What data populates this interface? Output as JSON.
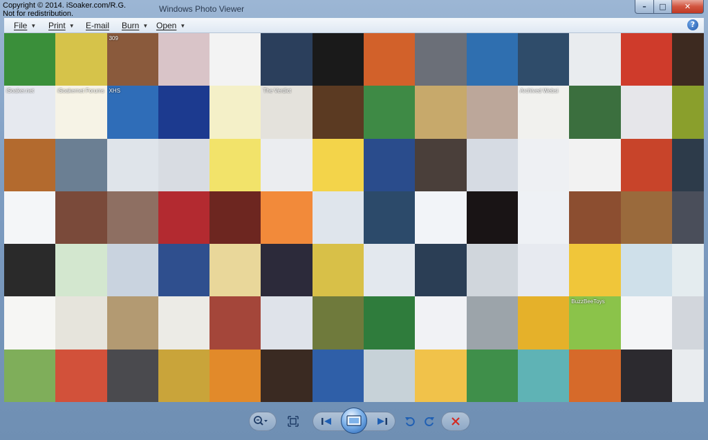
{
  "window": {
    "title": "Windows Photo Viewer",
    "copyright_line1": "Copyright © 2014. iSoaker.com/R.G.",
    "copyright_line2": "Not for redistribution.",
    "caption_buttons": {
      "minimize": "–",
      "maximize": "□",
      "close": "✕"
    }
  },
  "menu": {
    "items": [
      {
        "label": "File",
        "has_dropdown": true
      },
      {
        "label": "Print",
        "has_dropdown": true
      },
      {
        "label": "E-mail",
        "has_dropdown": false
      },
      {
        "label": "Burn",
        "has_dropdown": true
      },
      {
        "label": "Open",
        "has_dropdown": true
      }
    ],
    "help_label": "?"
  },
  "mosaic": {
    "tiles": [
      {
        "c": "#3a8f3a",
        "t": ""
      },
      {
        "c": "#d6c34a",
        "t": ""
      },
      {
        "c": "#8a5a3c",
        "t": "309"
      },
      {
        "c": "#d9c4c8",
        "t": ""
      },
      {
        "c": "#f3f3f3",
        "t": ""
      },
      {
        "c": "#2b3f5c",
        "t": ""
      },
      {
        "c": "#1a1a1a",
        "t": ""
      },
      {
        "c": "#d2612a",
        "t": ""
      },
      {
        "c": "#6b6f78",
        "t": ""
      },
      {
        "c": "#2f6fb0",
        "t": ""
      },
      {
        "c": "#2f4c6a",
        "t": ""
      },
      {
        "c": "#e9ecef",
        "t": ""
      },
      {
        "c": "#cf3b2b",
        "t": ""
      },
      {
        "c": "#3d2a20",
        "t": ""
      },
      {
        "c": "#e6e9ef",
        "t": "iSoaker.net"
      },
      {
        "c": "#f6f3e6",
        "t": "iSoakernet Forums"
      },
      {
        "c": "#2f6db8",
        "t": "XHS"
      },
      {
        "c": "#1c3a8f",
        "t": ""
      },
      {
        "c": "#f4f0c8",
        "t": ""
      },
      {
        "c": "#e4e2dc",
        "t": "The Verdict"
      },
      {
        "c": "#5b3a22",
        "t": ""
      },
      {
        "c": "#3e8a45",
        "t": ""
      },
      {
        "c": "#c7a96b",
        "t": ""
      },
      {
        "c": "#bca79a",
        "t": ""
      },
      {
        "c": "#f1f1ee",
        "t": "Archived Websi"
      },
      {
        "c": "#3b6f3e",
        "t": ""
      },
      {
        "c": "#e6e6ea",
        "t": ""
      },
      {
        "c": "#8a9f2c",
        "t": ""
      },
      {
        "c": "#b36a2e",
        "t": ""
      },
      {
        "c": "#6b7f93",
        "t": ""
      },
      {
        "c": "#dfe4ea",
        "t": ""
      },
      {
        "c": "#d8dce2",
        "t": ""
      },
      {
        "c": "#f2e36a",
        "t": ""
      },
      {
        "c": "#ebedf0",
        "t": ""
      },
      {
        "c": "#f3d44a",
        "t": ""
      },
      {
        "c": "#2a4c8c",
        "t": ""
      },
      {
        "c": "#4a3f3a",
        "t": ""
      },
      {
        "c": "#d6dbe3",
        "t": ""
      },
      {
        "c": "#eef0f3",
        "t": ""
      },
      {
        "c": "#f2f2f2",
        "t": ""
      },
      {
        "c": "#c8442a",
        "t": ""
      },
      {
        "c": "#2d3b4a",
        "t": ""
      },
      {
        "c": "#f4f6f8",
        "t": ""
      },
      {
        "c": "#7a4a3a",
        "t": ""
      },
      {
        "c": "#8e6f62",
        "t": ""
      },
      {
        "c": "#b32a30",
        "t": ""
      },
      {
        "c": "#6d2620",
        "t": ""
      },
      {
        "c": "#f28a3a",
        "t": ""
      },
      {
        "c": "#dfe5ec",
        "t": ""
      },
      {
        "c": "#2c4a6a",
        "t": ""
      },
      {
        "c": "#f2f4f8",
        "t": ""
      },
      {
        "c": "#191415",
        "t": ""
      },
      {
        "c": "#eef1f5",
        "t": ""
      },
      {
        "c": "#8c4e30",
        "t": ""
      },
      {
        "c": "#9a6a3c",
        "t": ""
      },
      {
        "c": "#4a4e5a",
        "t": ""
      },
      {
        "c": "#2a2a2a",
        "t": ""
      },
      {
        "c": "#d3e7cf",
        "t": ""
      },
      {
        "c": "#c9d3df",
        "t": ""
      },
      {
        "c": "#2f4f8e",
        "t": ""
      },
      {
        "c": "#e9d79a",
        "t": ""
      },
      {
        "c": "#2c2a3a",
        "t": ""
      },
      {
        "c": "#d8c048",
        "t": ""
      },
      {
        "c": "#e3e8ee",
        "t": ""
      },
      {
        "c": "#2b3e55",
        "t": ""
      },
      {
        "c": "#d0d6dc",
        "t": ""
      },
      {
        "c": "#e7eaf0",
        "t": ""
      },
      {
        "c": "#f0c63a",
        "t": ""
      },
      {
        "c": "#cfe0ea",
        "t": ""
      },
      {
        "c": "#e4ecef",
        "t": ""
      },
      {
        "c": "#f6f6f4",
        "t": ""
      },
      {
        "c": "#e6e4dc",
        "t": ""
      },
      {
        "c": "#b39a72",
        "t": ""
      },
      {
        "c": "#ecebe6",
        "t": ""
      },
      {
        "c": "#a4463a",
        "t": ""
      },
      {
        "c": "#dfe3ea",
        "t": ""
      },
      {
        "c": "#6f7a3c",
        "t": ""
      },
      {
        "c": "#2f7c3c",
        "t": ""
      },
      {
        "c": "#f1f2f5",
        "t": ""
      },
      {
        "c": "#9ca4aa",
        "t": ""
      },
      {
        "c": "#e5b12a",
        "t": ""
      },
      {
        "c": "#8bc34a",
        "t": "BuzzBeeToys"
      },
      {
        "c": "#f4f5f7",
        "t": ""
      },
      {
        "c": "#d2d6dc",
        "t": ""
      },
      {
        "c": "#7fae5a",
        "t": ""
      },
      {
        "c": "#d2513a",
        "t": ""
      },
      {
        "c": "#4a4a4e",
        "t": ""
      },
      {
        "c": "#c9a43a",
        "t": ""
      },
      {
        "c": "#e28a2a",
        "t": ""
      },
      {
        "c": "#3a2a22",
        "t": ""
      },
      {
        "c": "#2f5fa8",
        "t": ""
      },
      {
        "c": "#c7d2d8",
        "t": ""
      },
      {
        "c": "#f1c24a",
        "t": ""
      },
      {
        "c": "#3f8f4a",
        "t": ""
      },
      {
        "c": "#5fb3b5",
        "t": ""
      },
      {
        "c": "#d66a2a",
        "t": ""
      },
      {
        "c": "#2c2a2f",
        "t": ""
      },
      {
        "c": "#e9ecef",
        "t": ""
      }
    ]
  },
  "toolbar": {
    "buttons": [
      "zoom",
      "actual-size",
      "previous",
      "slideshow",
      "next",
      "rotate-left",
      "rotate-right",
      "delete"
    ]
  }
}
